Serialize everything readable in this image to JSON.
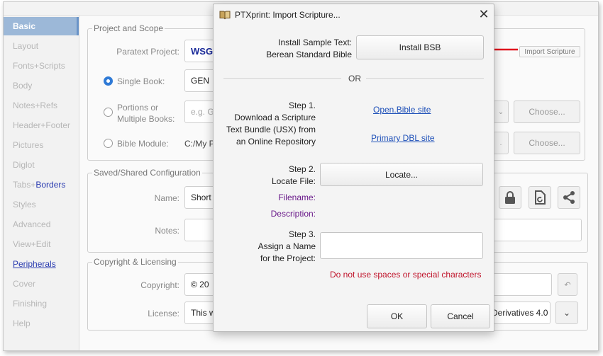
{
  "sidebar": {
    "items": [
      {
        "label": "Basic"
      },
      {
        "label": "Layout"
      },
      {
        "label": "Fonts+Scripts"
      },
      {
        "label": "Body"
      },
      {
        "label": "Notes+Refs"
      },
      {
        "label": "Header+Footer"
      },
      {
        "label": "Pictures"
      },
      {
        "label": "Diglot"
      },
      {
        "label_prefix": "Tabs+",
        "label_suffix": "Borders"
      },
      {
        "label": "Styles"
      },
      {
        "label": "Advanced"
      },
      {
        "label": "View+Edit"
      },
      {
        "label": "Peripherals"
      },
      {
        "label": "Cover"
      },
      {
        "label": "Finishing"
      },
      {
        "label": "Help"
      }
    ]
  },
  "project_scope": {
    "legend": "Project and Scope",
    "paratext_label": "Paratext Project:",
    "paratext_value": "WSG",
    "single_book_label": "Single Book:",
    "single_book_value": "GEN",
    "portions_label_1": "Portions or",
    "portions_label_2": "Multiple Books:",
    "portions_placeholder": "e.g. GE",
    "bible_module_label": "Bible Module:",
    "bible_module_value": "C:/My P",
    "choose_label": "Choose...",
    "import_scripture_label": "Import Scripture"
  },
  "saved_config": {
    "legend": "Saved/Shared Configuration",
    "name_label": "Name:",
    "name_value": "Short",
    "notes_label": "Notes:"
  },
  "copyright": {
    "legend": "Copyright & Licensing",
    "copyright_label": "Copyright:",
    "copyright_value": "© 20",
    "license_label": "License:",
    "license_value": "This w",
    "license_right_value": "Derivatives 4.0 I"
  },
  "dialog": {
    "title": "PTXprint: Import Scripture...",
    "install_label_1": "Install Sample Text:",
    "install_label_2": "Berean Standard Bible",
    "install_button": "Install BSB",
    "or_label": "OR",
    "step1": [
      "Step 1.",
      "Download a Scripture",
      "Text Bundle (USX) from",
      "an Online Repository"
    ],
    "open_bible_link": "Open.Bible site",
    "primary_dbl_link": "Primary DBL site",
    "step2": [
      "Step 2.",
      "Locate File:"
    ],
    "locate_button": "Locate...",
    "filename_label": "Filename:",
    "description_label": "Description:",
    "step3": [
      "Step 3.",
      "Assign a Name",
      "for the Project:"
    ],
    "project_name_value": "",
    "warning": "Do not use spaces or special characters",
    "ok_button": "OK",
    "cancel_button": "Cancel"
  },
  "colors": {
    "accent": "#2f7ad6",
    "link": "#1d4fb8",
    "warning": "#c0142b",
    "arrow": "#e0141e"
  }
}
